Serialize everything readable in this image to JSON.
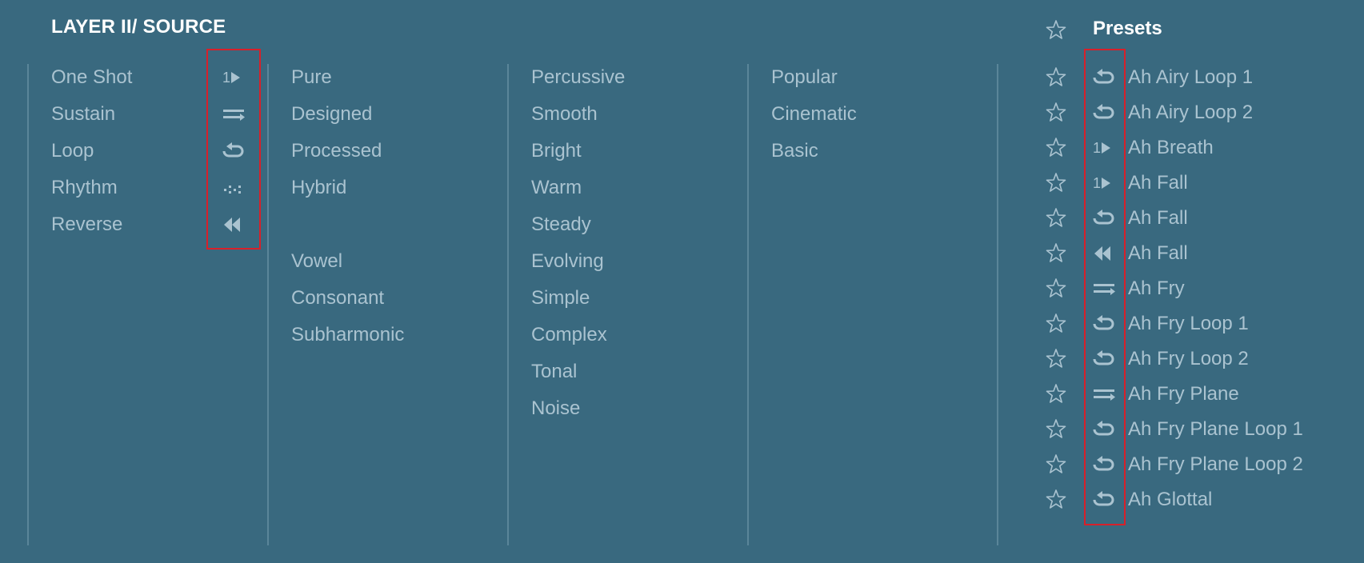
{
  "header": {
    "title": "LAYER II/ SOURCE",
    "presets_title": "Presets"
  },
  "playback_column": [
    {
      "label": "One Shot",
      "icon": "one-shot-icon"
    },
    {
      "label": "Sustain",
      "icon": "sustain-icon"
    },
    {
      "label": "Loop",
      "icon": "loop-icon"
    },
    {
      "label": "Rhythm",
      "icon": "rhythm-icon"
    },
    {
      "label": "Reverse",
      "icon": "reverse-icon"
    }
  ],
  "source_type_column": [
    "Pure",
    "Designed",
    "Processed",
    "Hybrid"
  ],
  "vocal_type_column": [
    "Vowel",
    "Consonant",
    "Subharmonic"
  ],
  "character_column": [
    "Percussive",
    "Smooth",
    "Bright",
    "Warm",
    "Steady",
    "Evolving",
    "Simple",
    "Complex",
    "Tonal",
    "Noise"
  ],
  "category_column": [
    "Popular",
    "Cinematic",
    "Basic"
  ],
  "presets": [
    {
      "label": "Ah Airy Loop 1",
      "icon": "loop-icon"
    },
    {
      "label": "Ah Airy Loop 2",
      "icon": "loop-icon"
    },
    {
      "label": "Ah Breath",
      "icon": "one-shot-icon"
    },
    {
      "label": "Ah Fall",
      "icon": "one-shot-icon"
    },
    {
      "label": "Ah Fall",
      "icon": "loop-icon"
    },
    {
      "label": "Ah Fall",
      "icon": "reverse-icon"
    },
    {
      "label": "Ah Fry",
      "icon": "sustain-icon"
    },
    {
      "label": "Ah Fry Loop 1",
      "icon": "loop-icon"
    },
    {
      "label": "Ah Fry Loop 2",
      "icon": "loop-icon"
    },
    {
      "label": "Ah Fry Plane",
      "icon": "sustain-icon"
    },
    {
      "label": "Ah Fry Plane Loop 1",
      "icon": "loop-icon"
    },
    {
      "label": "Ah Fry Plane Loop 2",
      "icon": "loop-icon"
    },
    {
      "label": "Ah Glottal",
      "icon": "loop-icon"
    }
  ],
  "colors": {
    "background": "#39697f",
    "text": "#aac3d0",
    "title": "#ffffff",
    "highlight_box": "#d8202a"
  }
}
